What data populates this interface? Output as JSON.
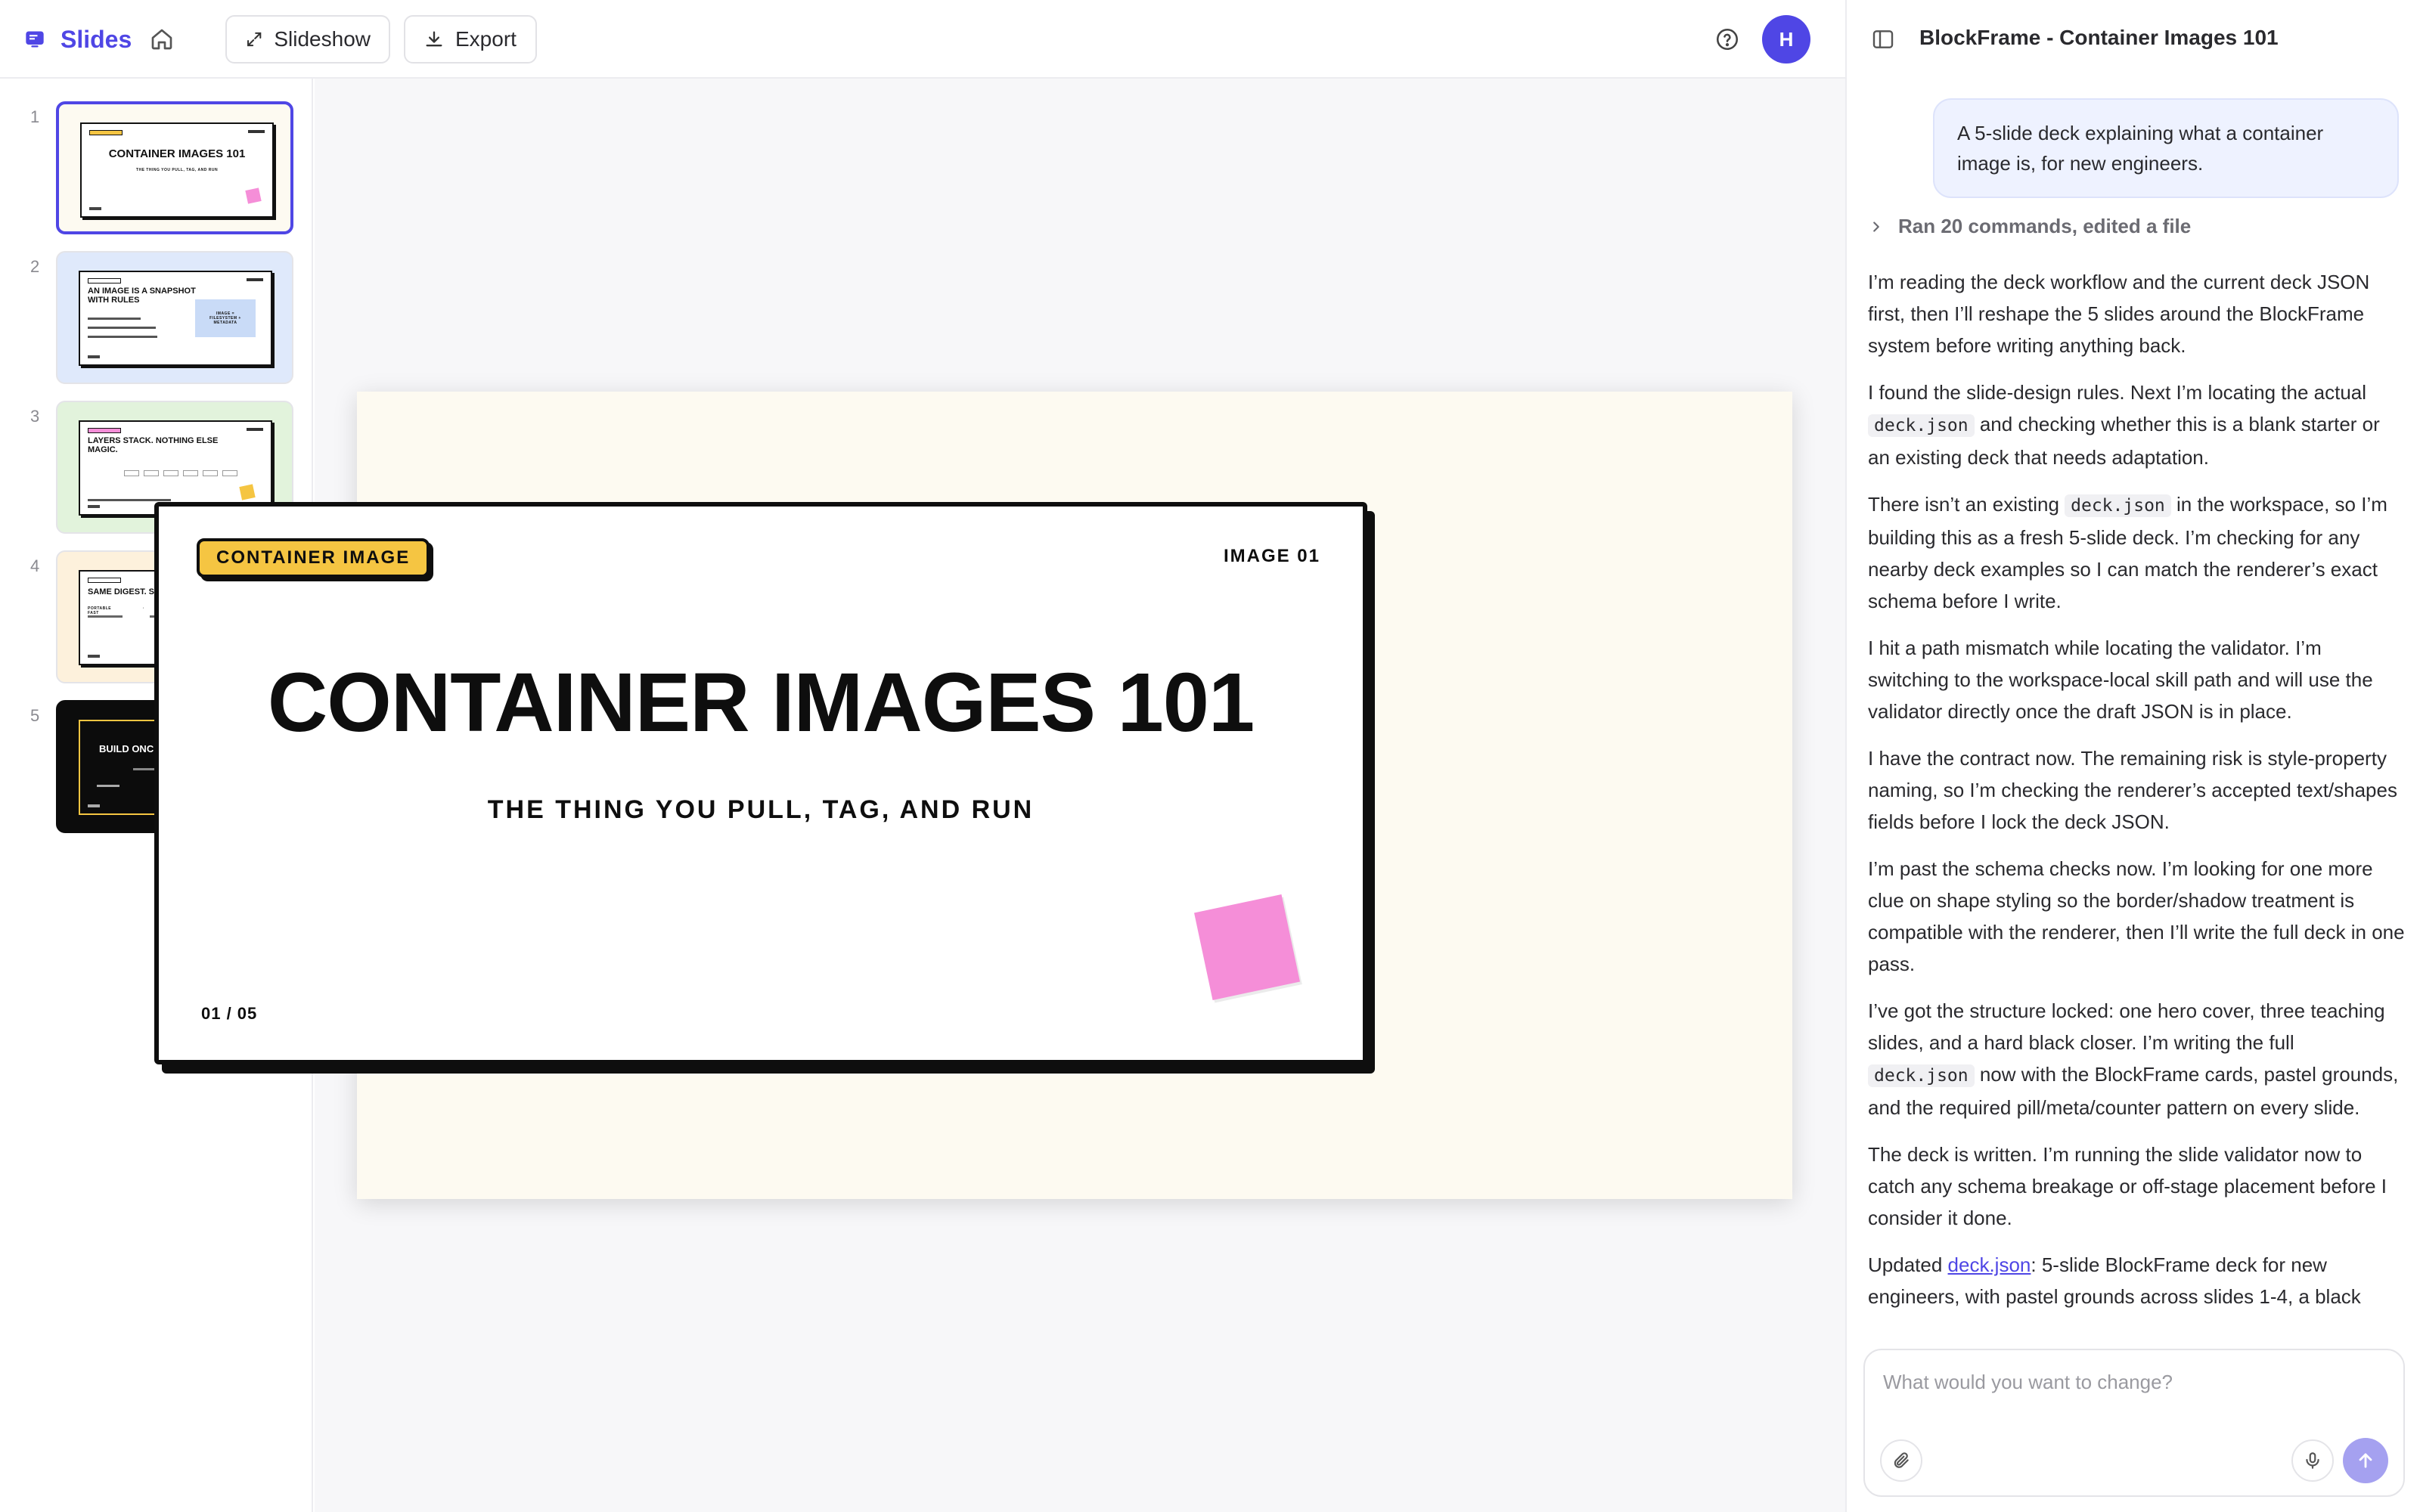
{
  "app": {
    "brand": "Slides",
    "icons": {
      "brand": "slides-logo-icon",
      "home": "home-icon",
      "help": "help-circle-icon"
    },
    "accent": "#4f46e5"
  },
  "toolbar": {
    "slideshow_label": "Slideshow",
    "export_label": "Export",
    "avatar_initial": "H"
  },
  "thumbnails": [
    {
      "num": "1",
      "title": "CONTAINER IMAGES 101",
      "subtitle": "THE THING YOU PULL, TAG, AND RUN",
      "background": "#fdfaf1",
      "selected": true
    },
    {
      "num": "2",
      "title": "AN IMAGE IS A SNAPSHOT WITH RULES",
      "subtitle": "IMAGE = FILESYSTEM + METADATA",
      "background": "#dfe9fb",
      "selected": false
    },
    {
      "num": "3",
      "title": "LAYERS STACK. NOTHING ELSE MAGIC.",
      "subtitle": "",
      "background": "#e2f3dc",
      "selected": false
    },
    {
      "num": "4",
      "title": "SAME DIGEST. SAME RESULT.",
      "subtitle": "PORTABLE · REPRODUCIBLE · FAST",
      "background": "#fdf1dc",
      "selected": false
    },
    {
      "num": "5",
      "title": "BUILD ONCE. SHIP THE DIGEST.",
      "subtitle": "",
      "background": "#0c0c0c",
      "selected": false
    }
  ],
  "slide": {
    "pill": "CONTAINER IMAGE",
    "meta": "IMAGE 01",
    "title": "CONTAINER IMAGES 101",
    "subtitle": "THE THING YOU PULL, TAG, AND RUN",
    "counter": "01 / 05",
    "colors": {
      "background": "#fdfaf1",
      "pill": "#f5c542",
      "sticker": "#f58ed8",
      "ink": "#0e0e0e"
    }
  },
  "chat": {
    "title": "BlockFrame - Container Images 101",
    "user_message": "A 5-slide deck explaining what a container image is, for new engineers.",
    "ran_summary": "Ran 20 commands, edited a file",
    "messages": [
      "I’m reading the deck workflow and the current deck JSON first, then I’ll reshape the 5 slides around the BlockFrame system before writing anything back.",
      "I found the slide-design rules. Next I’m locating the actual deck.json and checking whether this is a blank starter or an existing deck that needs adaptation.",
      "There isn’t an existing deck.json in the workspace, so I’m building this as a fresh 5-slide deck. I’m checking for any nearby deck examples so I can match the renderer’s exact schema before I write.",
      "I hit a path mismatch while locating the validator. I’m switching to the workspace-local skill path and will use the validator directly once the draft JSON is in place.",
      "I have the contract now. The remaining risk is style-property naming, so I’m checking the renderer’s accepted text/shapes fields before I lock the deck JSON.",
      "I’m past the schema checks now. I’m looking for one more clue on shape styling so the border/shadow treatment is compatible with the renderer, then I’ll write the full deck in one pass.",
      "I’ve got the structure locked: one hero cover, three teaching slides, and a hard black closer. I’m writing the full deck.json now with the BlockFrame cards, pastel grounds, and the required pill/meta/counter pattern on every slide.",
      "The deck is written. I’m running the slide validator now to catch any schema breakage or off-stage placement before I consider it done.",
      "Updated deck.json: 5-slide BlockFrame deck for new engineers, with pastel grounds across slides 1-4, a black"
    ],
    "code_token": "deck.json",
    "composer_placeholder": "What would you want to change?"
  }
}
